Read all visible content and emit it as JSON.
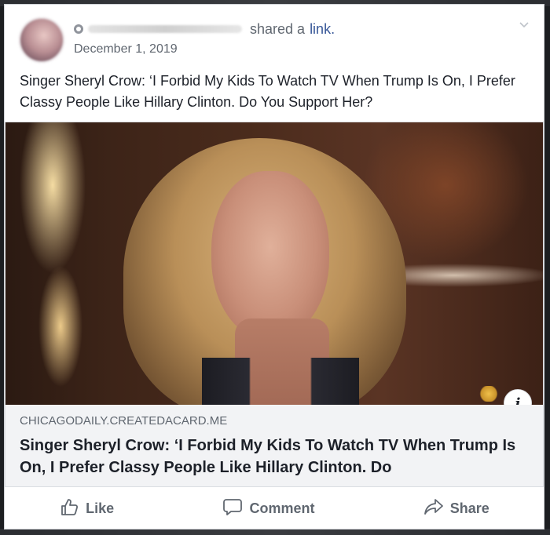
{
  "post": {
    "author_suffix": "shared a",
    "link_word": "link.",
    "date": "December 1, 2019",
    "text": "Singer Sheryl Crow: ‘I Forbid My Kids To Watch TV When Trump Is On, I Prefer Classy People Like Hillary Clinton. Do You Support Her?"
  },
  "link_preview": {
    "domain": "CHICAGODAILY.CREATEDACARD.ME",
    "headline": "Singer Sheryl Crow: ‘I Forbid My Kids To Watch TV When Trump Is On, I Prefer Classy People Like Hillary Clinton. Do",
    "info_glyph": "i"
  },
  "actions": {
    "like_label": "Like",
    "comment_label": "Comment",
    "share_label": "Share"
  },
  "icons": {
    "options": "chevron-down-icon",
    "like": "thumbs-up-icon",
    "comment": "speech-bubble-icon",
    "share": "share-arrow-icon",
    "info": "info-icon"
  },
  "colors": {
    "link": "#385898",
    "secondary_text": "#606770",
    "primary_text": "#1d2129",
    "caption_bg": "#f2f3f5"
  }
}
